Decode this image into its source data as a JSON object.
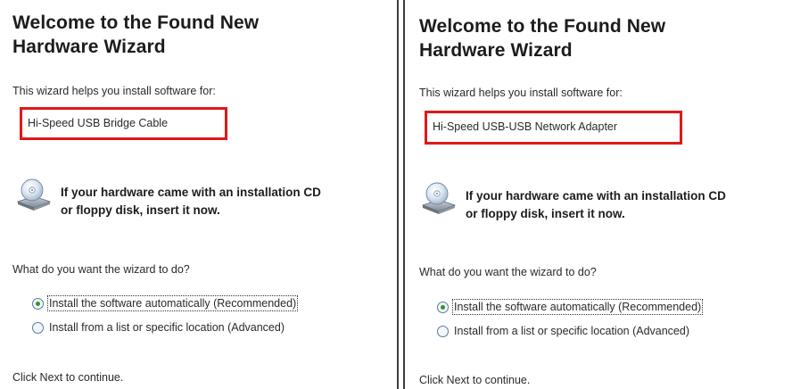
{
  "panels": [
    {
      "title_line1": "Welcome to the Found New",
      "title_line2": "Hardware Wizard",
      "intro": "This wizard helps you install software for:",
      "device": "Hi-Speed USB Bridge Cable",
      "cd_note_line1": "If your hardware came with an installation CD",
      "cd_note_line2": "or floppy disk, insert it now.",
      "question": "What do you want the wizard to do?",
      "options": [
        {
          "label": "Install the software automatically (Recommended)",
          "selected": true
        },
        {
          "label": "Install from a list or specific location (Advanced)",
          "selected": false
        }
      ],
      "footer": "Click Next to continue."
    },
    {
      "title_line1": "Welcome to the Found New",
      "title_line2": "Hardware Wizard",
      "intro": "This wizard helps you install software for:",
      "device": "Hi-Speed USB-USB Network Adapter",
      "cd_note_line1": "If your hardware came with an installation CD",
      "cd_note_line2": "or floppy disk, insert it now.",
      "question": "What do you want the wizard to do?",
      "options": [
        {
          "label": "Install the software automatically (Recommended)",
          "selected": true
        },
        {
          "label": "Install from a list or specific location (Advanced)",
          "selected": false
        }
      ],
      "footer": "Click Next to continue."
    }
  ],
  "colors": {
    "highlight_box": "#e01818",
    "divider": "#3c3c3c",
    "radio_selected": "#2a9a2a"
  },
  "icons": {
    "cd_drive": "cd-drive-icon"
  }
}
